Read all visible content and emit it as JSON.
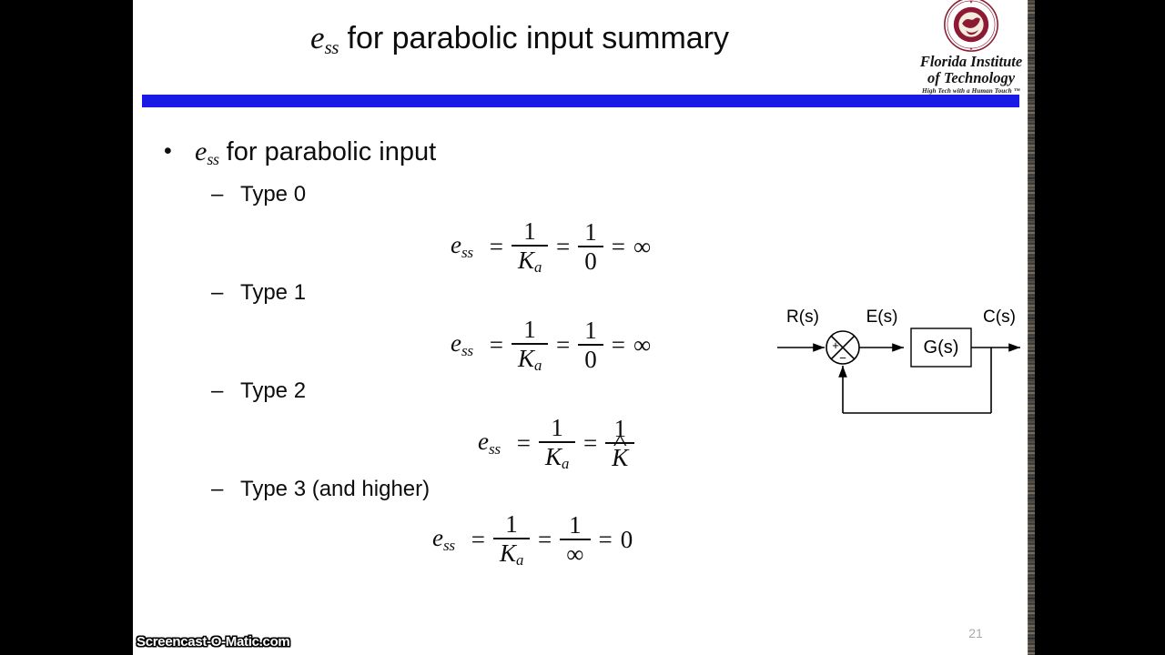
{
  "slide": {
    "title": {
      "var": "e",
      "var_sub": "ss",
      "rest": " for parabolic input summary"
    },
    "page_number": "21",
    "accent_color": "#1a1ae6",
    "logo": {
      "seal_name": "florida-tech-seal-icon",
      "seal_color": "#8b1a32",
      "line1": "Florida Institute",
      "line2": "of Technology",
      "tagline": "High Tech with a Human Touch ™"
    },
    "bullet": {
      "marker": "•",
      "var": "e",
      "var_sub": "ss",
      "rest": " for parabolic input"
    },
    "items": [
      {
        "dash": "–",
        "label": "Type 0",
        "equation": {
          "lhs_var": "e",
          "lhs_sub": "ss",
          "eq1": "=",
          "f1_num": "1",
          "f1_den": "K",
          "f1_den_sub": "a",
          "eq2": "=",
          "f2_num": "1",
          "f2_den": "0",
          "eq3": "=",
          "result": "∞"
        }
      },
      {
        "dash": "–",
        "label": "Type 1",
        "equation": {
          "lhs_var": "e",
          "lhs_sub": "ss",
          "eq1": "=",
          "f1_num": "1",
          "f1_den": "K",
          "f1_den_sub": "a",
          "eq2": "=",
          "f2_num": "1",
          "f2_den": "0",
          "eq3": "=",
          "result": "∞"
        }
      },
      {
        "dash": "–",
        "label": "Type 2",
        "equation": {
          "lhs_var": "e",
          "lhs_sub": "ss",
          "eq1": "=",
          "f1_num": "1",
          "f1_den": "K",
          "f1_den_sub": "a",
          "eq2": "=",
          "f2_num": "1",
          "f2_den": "K",
          "f2_den_hat": true,
          "eq3": "",
          "result": ""
        }
      },
      {
        "dash": "–",
        "label": "Type 3 (and higher)",
        "equation": {
          "lhs_var": "e",
          "lhs_sub": "ss",
          "eq1": "=",
          "f1_num": "1",
          "f1_den": "K",
          "f1_den_sub": "a",
          "eq2": "=",
          "f2_num": "1",
          "f2_den": "∞",
          "eq3": "=",
          "result": "0"
        }
      }
    ],
    "diagram": {
      "name": "unity-feedback-block-diagram",
      "input_label": "R(s)",
      "error_label": "E(s)",
      "block_label": "G(s)",
      "output_label": "C(s)",
      "sum_plus": "+",
      "sum_minus": "−"
    }
  },
  "overlay": {
    "watermark": "Screencast-O-Matic.com"
  }
}
